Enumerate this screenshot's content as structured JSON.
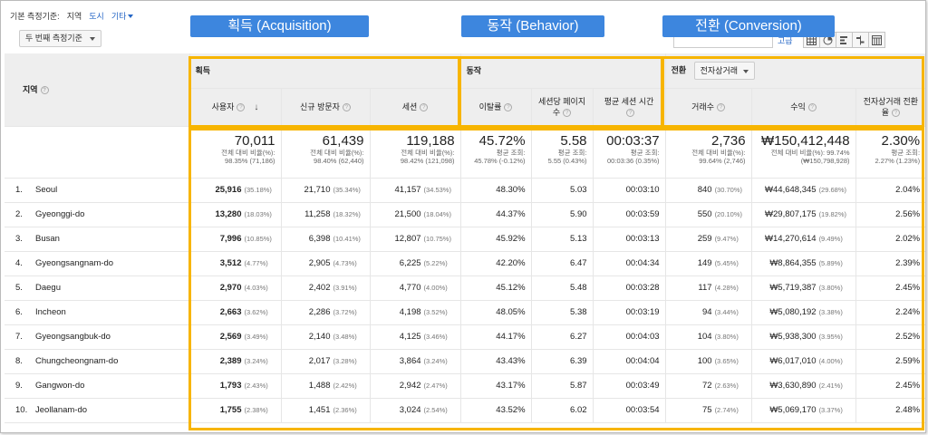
{
  "dimension_bar": {
    "label": "기본 측정기준:",
    "current": "지역",
    "city": "도시",
    "other": "기타"
  },
  "secondary_dimension": "두 번째 측정기준",
  "advanced_label": "고급",
  "callouts": {
    "acquisition": "획득 (Acquisition)",
    "behavior": "동작 (Behavior)",
    "conversion": "전환 (Conversion)"
  },
  "groups": {
    "acquisition": "획득",
    "behavior": "동작",
    "conversion": "전환",
    "conversion_select": "전자상거래"
  },
  "columns": {
    "region": "지역",
    "users": "사용자",
    "new_users": "신규 방문자",
    "sessions": "세션",
    "bounce": "이탈률",
    "pages": "세션당 페이지 수",
    "duration": "평균 세션 시간",
    "transactions": "거래수",
    "revenue": "수익",
    "ecom_rate": "전자상거래 전환율"
  },
  "totals": {
    "users": {
      "value": "70,011",
      "sub1": "전체 대비 비율(%):",
      "sub2": "98.35% (71,186)"
    },
    "new_users": {
      "value": "61,439",
      "sub1": "전체 대비 비율(%):",
      "sub2": "98.40% (62,440)"
    },
    "sessions": {
      "value": "119,188",
      "sub1": "전체 대비 비율(%):",
      "sub2": "98.42% (121,098)"
    },
    "bounce": {
      "value": "45.72%",
      "sub1": "평균 조회:",
      "sub2": "45.78% (-0.12%)"
    },
    "pages": {
      "value": "5.58",
      "sub1": "평균 조회:",
      "sub2": "5.55 (0.43%)"
    },
    "duration": {
      "value": "00:03:37",
      "sub1": "평균 조회:",
      "sub2": "00:03:36 (0.35%)"
    },
    "transactions": {
      "value": "2,736",
      "sub1": "전체 대비 비율(%):",
      "sub2": "99.64% (2,746)"
    },
    "revenue": {
      "value": "₩150,412,448",
      "sub1": "전체 대비 비율(%): 99.74%",
      "sub2": "(₩150,798,928)"
    },
    "ecom_rate": {
      "value": "2.30%",
      "sub1": "평균 조회:",
      "sub2": "2.27% (1.23%)"
    }
  },
  "rows": [
    {
      "idx": "1.",
      "region": "Seoul",
      "users": "25,916",
      "users_pct": "(35.18%)",
      "new_users": "21,710",
      "new_users_pct": "(35.34%)",
      "sessions": "41,157",
      "sessions_pct": "(34.53%)",
      "bounce": "48.30%",
      "pages": "5.03",
      "duration": "00:03:10",
      "transactions": "840",
      "transactions_pct": "(30.70%)",
      "revenue": "₩44,648,345",
      "revenue_pct": "(29.68%)",
      "ecom_rate": "2.04%"
    },
    {
      "idx": "2.",
      "region": "Gyeonggi-do",
      "users": "13,280",
      "users_pct": "(18.03%)",
      "new_users": "11,258",
      "new_users_pct": "(18.32%)",
      "sessions": "21,500",
      "sessions_pct": "(18.04%)",
      "bounce": "44.37%",
      "pages": "5.90",
      "duration": "00:03:59",
      "transactions": "550",
      "transactions_pct": "(20.10%)",
      "revenue": "₩29,807,175",
      "revenue_pct": "(19.82%)",
      "ecom_rate": "2.56%"
    },
    {
      "idx": "3.",
      "region": "Busan",
      "users": "7,996",
      "users_pct": "(10.85%)",
      "new_users": "6,398",
      "new_users_pct": "(10.41%)",
      "sessions": "12,807",
      "sessions_pct": "(10.75%)",
      "bounce": "45.92%",
      "pages": "5.13",
      "duration": "00:03:13",
      "transactions": "259",
      "transactions_pct": "(9.47%)",
      "revenue": "₩14,270,614",
      "revenue_pct": "(9.49%)",
      "ecom_rate": "2.02%"
    },
    {
      "idx": "4.",
      "region": "Gyeongsangnam-do",
      "users": "3,512",
      "users_pct": "(4.77%)",
      "new_users": "2,905",
      "new_users_pct": "(4.73%)",
      "sessions": "6,225",
      "sessions_pct": "(5.22%)",
      "bounce": "42.20%",
      "pages": "6.47",
      "duration": "00:04:34",
      "transactions": "149",
      "transactions_pct": "(5.45%)",
      "revenue": "₩8,864,355",
      "revenue_pct": "(5.89%)",
      "ecom_rate": "2.39%"
    },
    {
      "idx": "5.",
      "region": "Daegu",
      "users": "2,970",
      "users_pct": "(4.03%)",
      "new_users": "2,402",
      "new_users_pct": "(3.91%)",
      "sessions": "4,770",
      "sessions_pct": "(4.00%)",
      "bounce": "45.12%",
      "pages": "5.48",
      "duration": "00:03:28",
      "transactions": "117",
      "transactions_pct": "(4.28%)",
      "revenue": "₩5,719,387",
      "revenue_pct": "(3.80%)",
      "ecom_rate": "2.45%"
    },
    {
      "idx": "6.",
      "region": "Incheon",
      "users": "2,663",
      "users_pct": "(3.62%)",
      "new_users": "2,286",
      "new_users_pct": "(3.72%)",
      "sessions": "4,198",
      "sessions_pct": "(3.52%)",
      "bounce": "48.05%",
      "pages": "5.38",
      "duration": "00:03:19",
      "transactions": "94",
      "transactions_pct": "(3.44%)",
      "revenue": "₩5,080,192",
      "revenue_pct": "(3.38%)",
      "ecom_rate": "2.24%"
    },
    {
      "idx": "7.",
      "region": "Gyeongsangbuk-do",
      "users": "2,569",
      "users_pct": "(3.49%)",
      "new_users": "2,140",
      "new_users_pct": "(3.48%)",
      "sessions": "4,125",
      "sessions_pct": "(3.46%)",
      "bounce": "44.17%",
      "pages": "6.27",
      "duration": "00:04:03",
      "transactions": "104",
      "transactions_pct": "(3.80%)",
      "revenue": "₩5,938,300",
      "revenue_pct": "(3.95%)",
      "ecom_rate": "2.52%"
    },
    {
      "idx": "8.",
      "region": "Chungcheongnam-do",
      "users": "2,389",
      "users_pct": "(3.24%)",
      "new_users": "2,017",
      "new_users_pct": "(3.28%)",
      "sessions": "3,864",
      "sessions_pct": "(3.24%)",
      "bounce": "43.43%",
      "pages": "6.39",
      "duration": "00:04:04",
      "transactions": "100",
      "transactions_pct": "(3.65%)",
      "revenue": "₩6,017,010",
      "revenue_pct": "(4.00%)",
      "ecom_rate": "2.59%"
    },
    {
      "idx": "9.",
      "region": "Gangwon-do",
      "users": "1,793",
      "users_pct": "(2.43%)",
      "new_users": "1,488",
      "new_users_pct": "(2.42%)",
      "sessions": "2,942",
      "sessions_pct": "(2.47%)",
      "bounce": "43.17%",
      "pages": "5.87",
      "duration": "00:03:49",
      "transactions": "72",
      "transactions_pct": "(2.63%)",
      "revenue": "₩3,630,890",
      "revenue_pct": "(2.41%)",
      "ecom_rate": "2.45%"
    },
    {
      "idx": "10.",
      "region": "Jeollanam-do",
      "users": "1,755",
      "users_pct": "(2.38%)",
      "new_users": "1,451",
      "new_users_pct": "(2.36%)",
      "sessions": "3,024",
      "sessions_pct": "(2.54%)",
      "bounce": "43.52%",
      "pages": "6.02",
      "duration": "00:03:54",
      "transactions": "75",
      "transactions_pct": "(2.74%)",
      "revenue": "₩5,069,170",
      "revenue_pct": "(3.37%)",
      "ecom_rate": "2.48%"
    }
  ],
  "colors": {
    "callout": "#3d86de",
    "highlight": "#f7b500",
    "link": "#2566c6"
  }
}
